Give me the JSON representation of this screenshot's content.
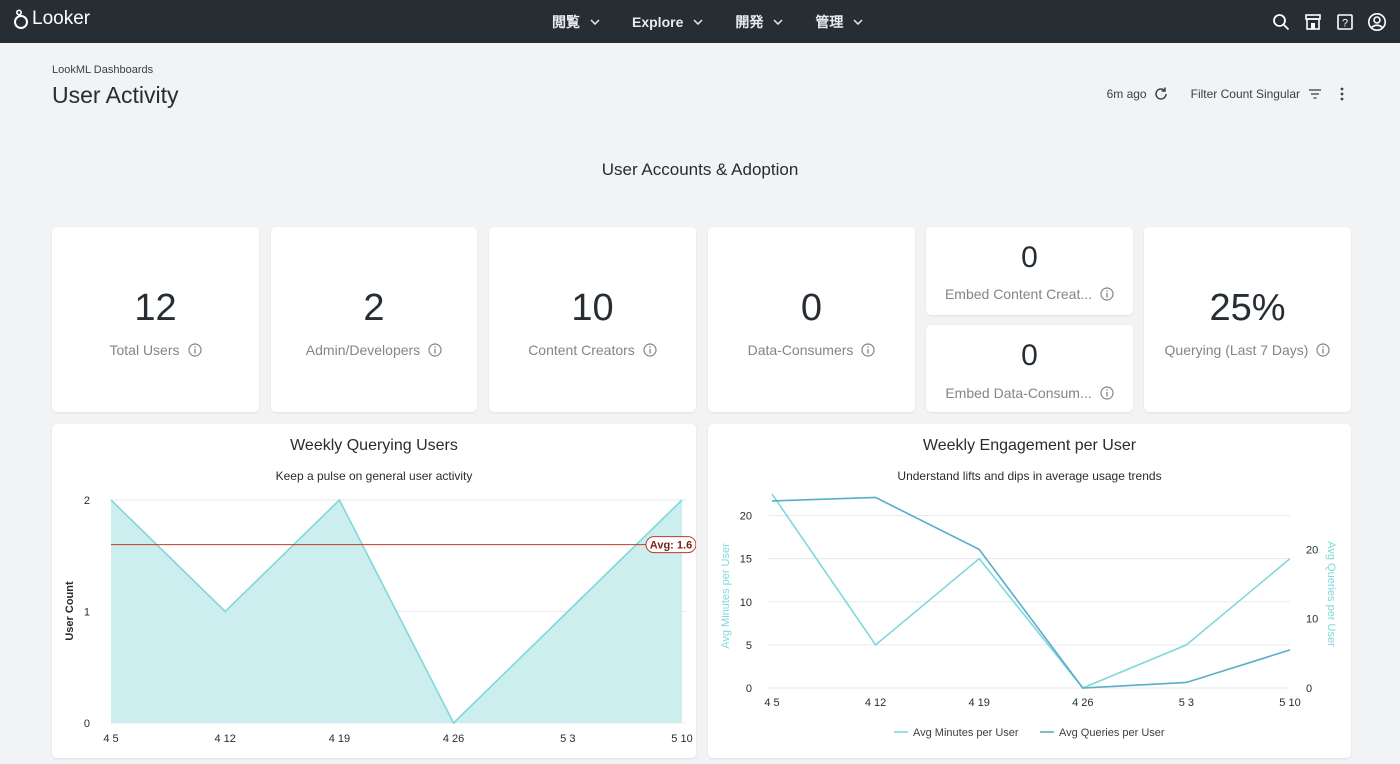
{
  "topbar": {
    "logo_text": "Looker",
    "nav": [
      {
        "label": "閲覧"
      },
      {
        "label": "Explore"
      },
      {
        "label": "開発"
      },
      {
        "label": "管理"
      }
    ]
  },
  "header": {
    "breadcrumb": "LookML Dashboards",
    "title": "User Activity",
    "last_updated": "6m ago",
    "filter_label": "Filter Count Singular"
  },
  "section_title": "User Accounts & Adoption",
  "kpis": {
    "total_users": {
      "value": "12",
      "label": "Total Users"
    },
    "admin_developers": {
      "value": "2",
      "label": "Admin/Developers"
    },
    "content_creators": {
      "value": "10",
      "label": "Content Creators"
    },
    "data_consumers": {
      "value": "0",
      "label": "Data-Consumers"
    },
    "embed_content_creators": {
      "value": "0",
      "label": "Embed Content Creat..."
    },
    "embed_data_consumers": {
      "value": "0",
      "label": "Embed Data-Consum..."
    },
    "querying_last_7_days": {
      "value": "25%",
      "label": "Querying (Last 7 Days)"
    }
  },
  "colors": {
    "accent_teal": "#7fd8dc",
    "area_fill": "#cdeeee",
    "series_dark": "#5aaec8",
    "avg_line": "#c0392b",
    "topbar": "#262d33"
  },
  "chart_data": [
    {
      "type": "area",
      "title": "Weekly Querying Users",
      "subtitle": "Keep a pulse on general user activity",
      "ylabel": "User Count",
      "x": [
        "4 5",
        "4 12",
        "4 19",
        "4 26",
        "5 3",
        "5 10"
      ],
      "series": [
        {
          "values": [
            2,
            1,
            2,
            0,
            1,
            2
          ]
        }
      ],
      "ylim": [
        0,
        2
      ],
      "yticks": [
        "0",
        "1",
        "2"
      ],
      "reference_line": {
        "label": "Avg: 1.6",
        "value": 1.6
      },
      "grid": true
    },
    {
      "type": "line",
      "title": "Weekly Engagement per User",
      "subtitle": "Understand lifts and dips in average usage trends",
      "ylabel": "Avg Minutes per User",
      "y2label": "Avg Queries per User",
      "x": [
        "4 5",
        "4 12",
        "4 19",
        "4 26",
        "5 3",
        "5 10"
      ],
      "series": [
        {
          "name": "Avg Minutes per User",
          "axis": "left",
          "values": [
            22.5,
            5,
            15,
            0,
            5,
            15
          ]
        },
        {
          "name": "Avg Queries per User",
          "axis": "right",
          "values": [
            27,
            27.5,
            20,
            0,
            0.8,
            5.5
          ]
        }
      ],
      "ylim": [
        0,
        22.5
      ],
      "y2lim": [
        0,
        28
      ],
      "yticks": [
        "0",
        "5",
        "10",
        "15",
        "20"
      ],
      "y2ticks": [
        "0",
        "10",
        "20"
      ],
      "legend": "bottom",
      "grid": true
    }
  ]
}
